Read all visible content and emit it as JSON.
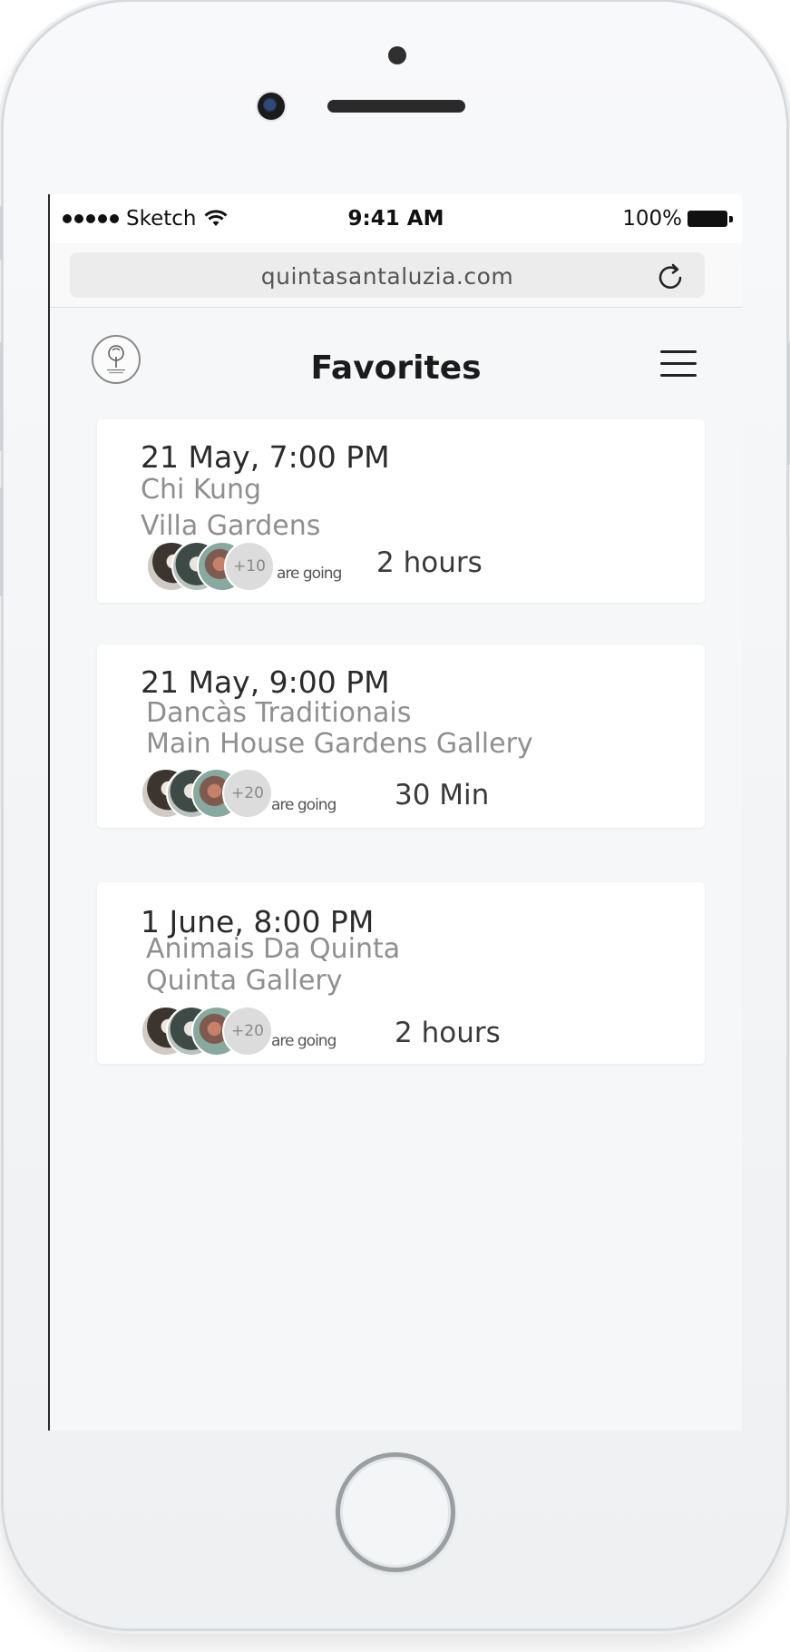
{
  "status_bar": {
    "carrier": "Sketch",
    "time": "9:41 AM",
    "battery": "100%"
  },
  "browser": {
    "url": "quintasantaluzia.com"
  },
  "header": {
    "title": "Favorites"
  },
  "icons": {
    "wifi": "wifi-icon",
    "battery": "battery-icon",
    "reload": "reload-icon",
    "menu": "hamburger-menu-icon",
    "logo": "tree-logo"
  },
  "events": [
    {
      "date": "21 May, 7:00 PM",
      "name": "Chi Kung",
      "location": "Villa Gardens",
      "attendee_extra": "+10",
      "going_label": "are going",
      "duration": "2 hours"
    },
    {
      "date": "21 May, 9:00 PM",
      "name": "Dancàs Traditionais",
      "location": "Main House Gardens Gallery",
      "attendee_extra": "+20",
      "going_label": "are going",
      "duration": "30 Min"
    },
    {
      "date": "1 June, 8:00 PM",
      "name": "Animais Da Quinta",
      "location": "Quinta Gallery",
      "attendee_extra": "+20",
      "going_label": "are going",
      "duration": "2 hours"
    }
  ]
}
